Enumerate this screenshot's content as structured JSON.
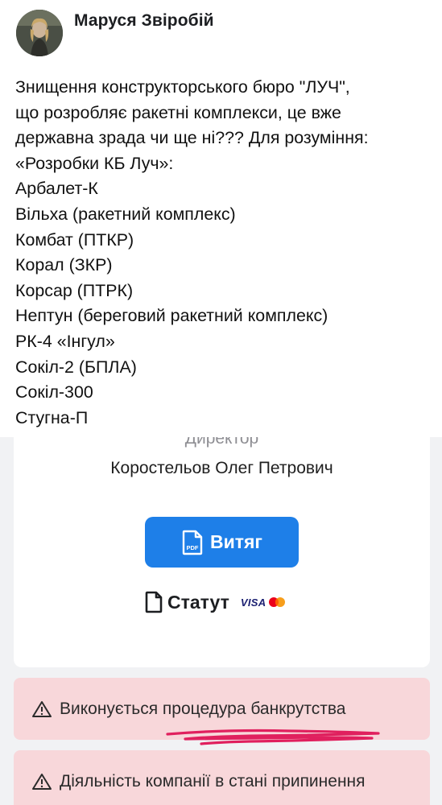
{
  "post": {
    "author": "Маруся Звіробій",
    "lines": [
      "Знищення конструкторського бюро \"ЛУЧ\",",
      "що розробляє ракетні комплекси, це вже",
      "державна зрада чи ще ні??? Для розуміння:",
      "«Розробки КБ Луч»:",
      "Арбалет-К",
      "Вільха (ракетний комплекс)",
      "Комбат (ПТКР)",
      "Корал (ЗКР)",
      "Корсар (ПТРК)",
      "Нептун (береговий ракетний комплекс)",
      "РК-4 «Інгул»",
      "Сокіл-2 (БПЛА)",
      "Сокіл-300",
      "Стугна-П"
    ]
  },
  "company": {
    "role": "Директор",
    "person": "Коростельов Олег Петрович",
    "extract_label": "Витяг",
    "pdf_badge": "PDF",
    "statute_label": "Статут",
    "visa_text": "VISA",
    "alerts": [
      "Виконується процедура банкрутства",
      "Діяльність компанії в стані припинення"
    ]
  },
  "icons": {
    "avatar": "avatar-photo",
    "pdf": "pdf-file-icon",
    "document": "document-icon",
    "warning": "warning-triangle-icon",
    "card": "visa-mastercard-icon"
  },
  "colors": {
    "button": "#1e7fe8",
    "alert_bg": "#f8d7da",
    "scribble": "#e0205e",
    "muted": "#8e8e93"
  }
}
